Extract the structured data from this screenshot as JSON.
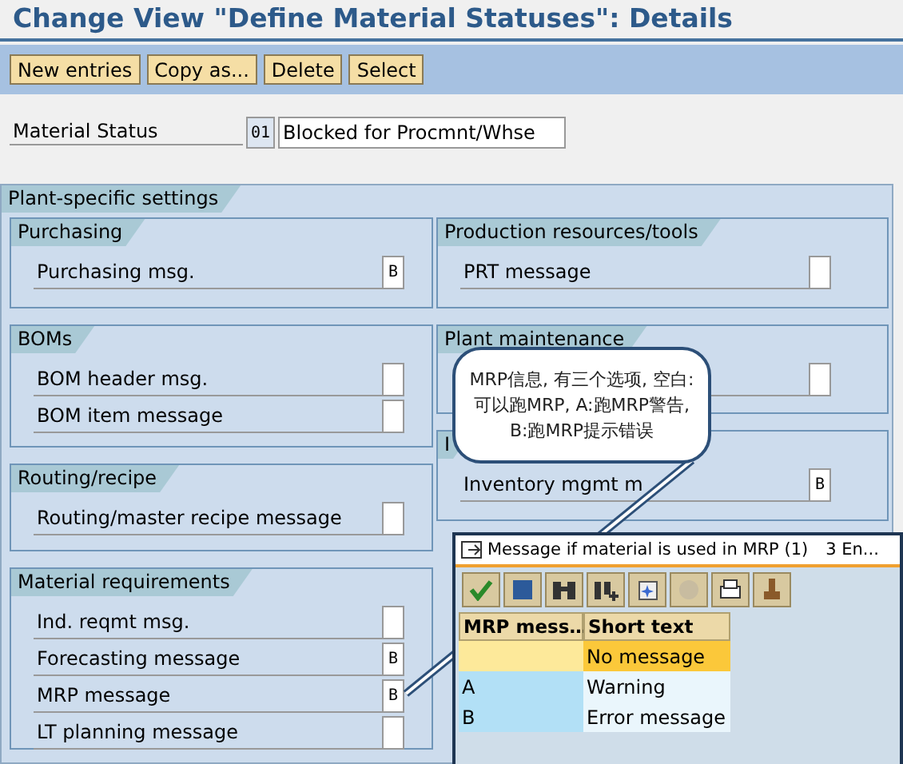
{
  "title": "Change View \"Define Material Statuses\": Details",
  "toolbar": [
    "New entries",
    "Copy as...",
    "Delete",
    "Select"
  ],
  "material_status": {
    "label": "Material Status",
    "code": "01",
    "value": "Blocked for Procmnt/Whse"
  },
  "section": {
    "title": "Plant-specific settings",
    "left_groups": [
      {
        "title": "Purchasing",
        "fields": [
          {
            "label": "Purchasing msg.",
            "value": "B"
          }
        ]
      },
      {
        "title": "BOMs",
        "fields": [
          {
            "label": "BOM header msg."
          },
          {
            "label": "BOM item message"
          }
        ]
      },
      {
        "title": "Routing/recipe",
        "fields": [
          {
            "label": "Routing/master recipe message"
          }
        ]
      },
      {
        "title": "Material requirements",
        "fields": [
          {
            "label": "Ind. reqmt msg."
          },
          {
            "label": "Forecasting message",
            "value": "B"
          },
          {
            "label": "MRP message",
            "value": "B"
          },
          {
            "label": "LT planning message"
          }
        ]
      }
    ],
    "right_groups": [
      {
        "title": "Production resources/tools",
        "fields": [
          {
            "label": "PRT message"
          }
        ]
      },
      {
        "title": "Plant maintenance",
        "fields": [
          {
            "kind": "unlabeled"
          }
        ]
      },
      {
        "title": "I",
        "fields": [
          {
            "label": "Inventory mgmt m",
            "value": "B"
          }
        ]
      }
    ]
  },
  "callout": "MRP信息, 有三个选项, 空白:可以跑MRP, A:跑MRP警告, B:跑MRP提示错误",
  "popup": {
    "title": "Message if material is used in MRP (1)",
    "count": "3 En...",
    "columns": [
      "MRP mess…",
      "Short text"
    ],
    "rows": [
      {
        "code": "",
        "text": "No message",
        "selected": true
      },
      {
        "code": "A",
        "text": "Warning",
        "selected": false
      },
      {
        "code": "B",
        "text": "Error message",
        "selected": false
      }
    ]
  }
}
